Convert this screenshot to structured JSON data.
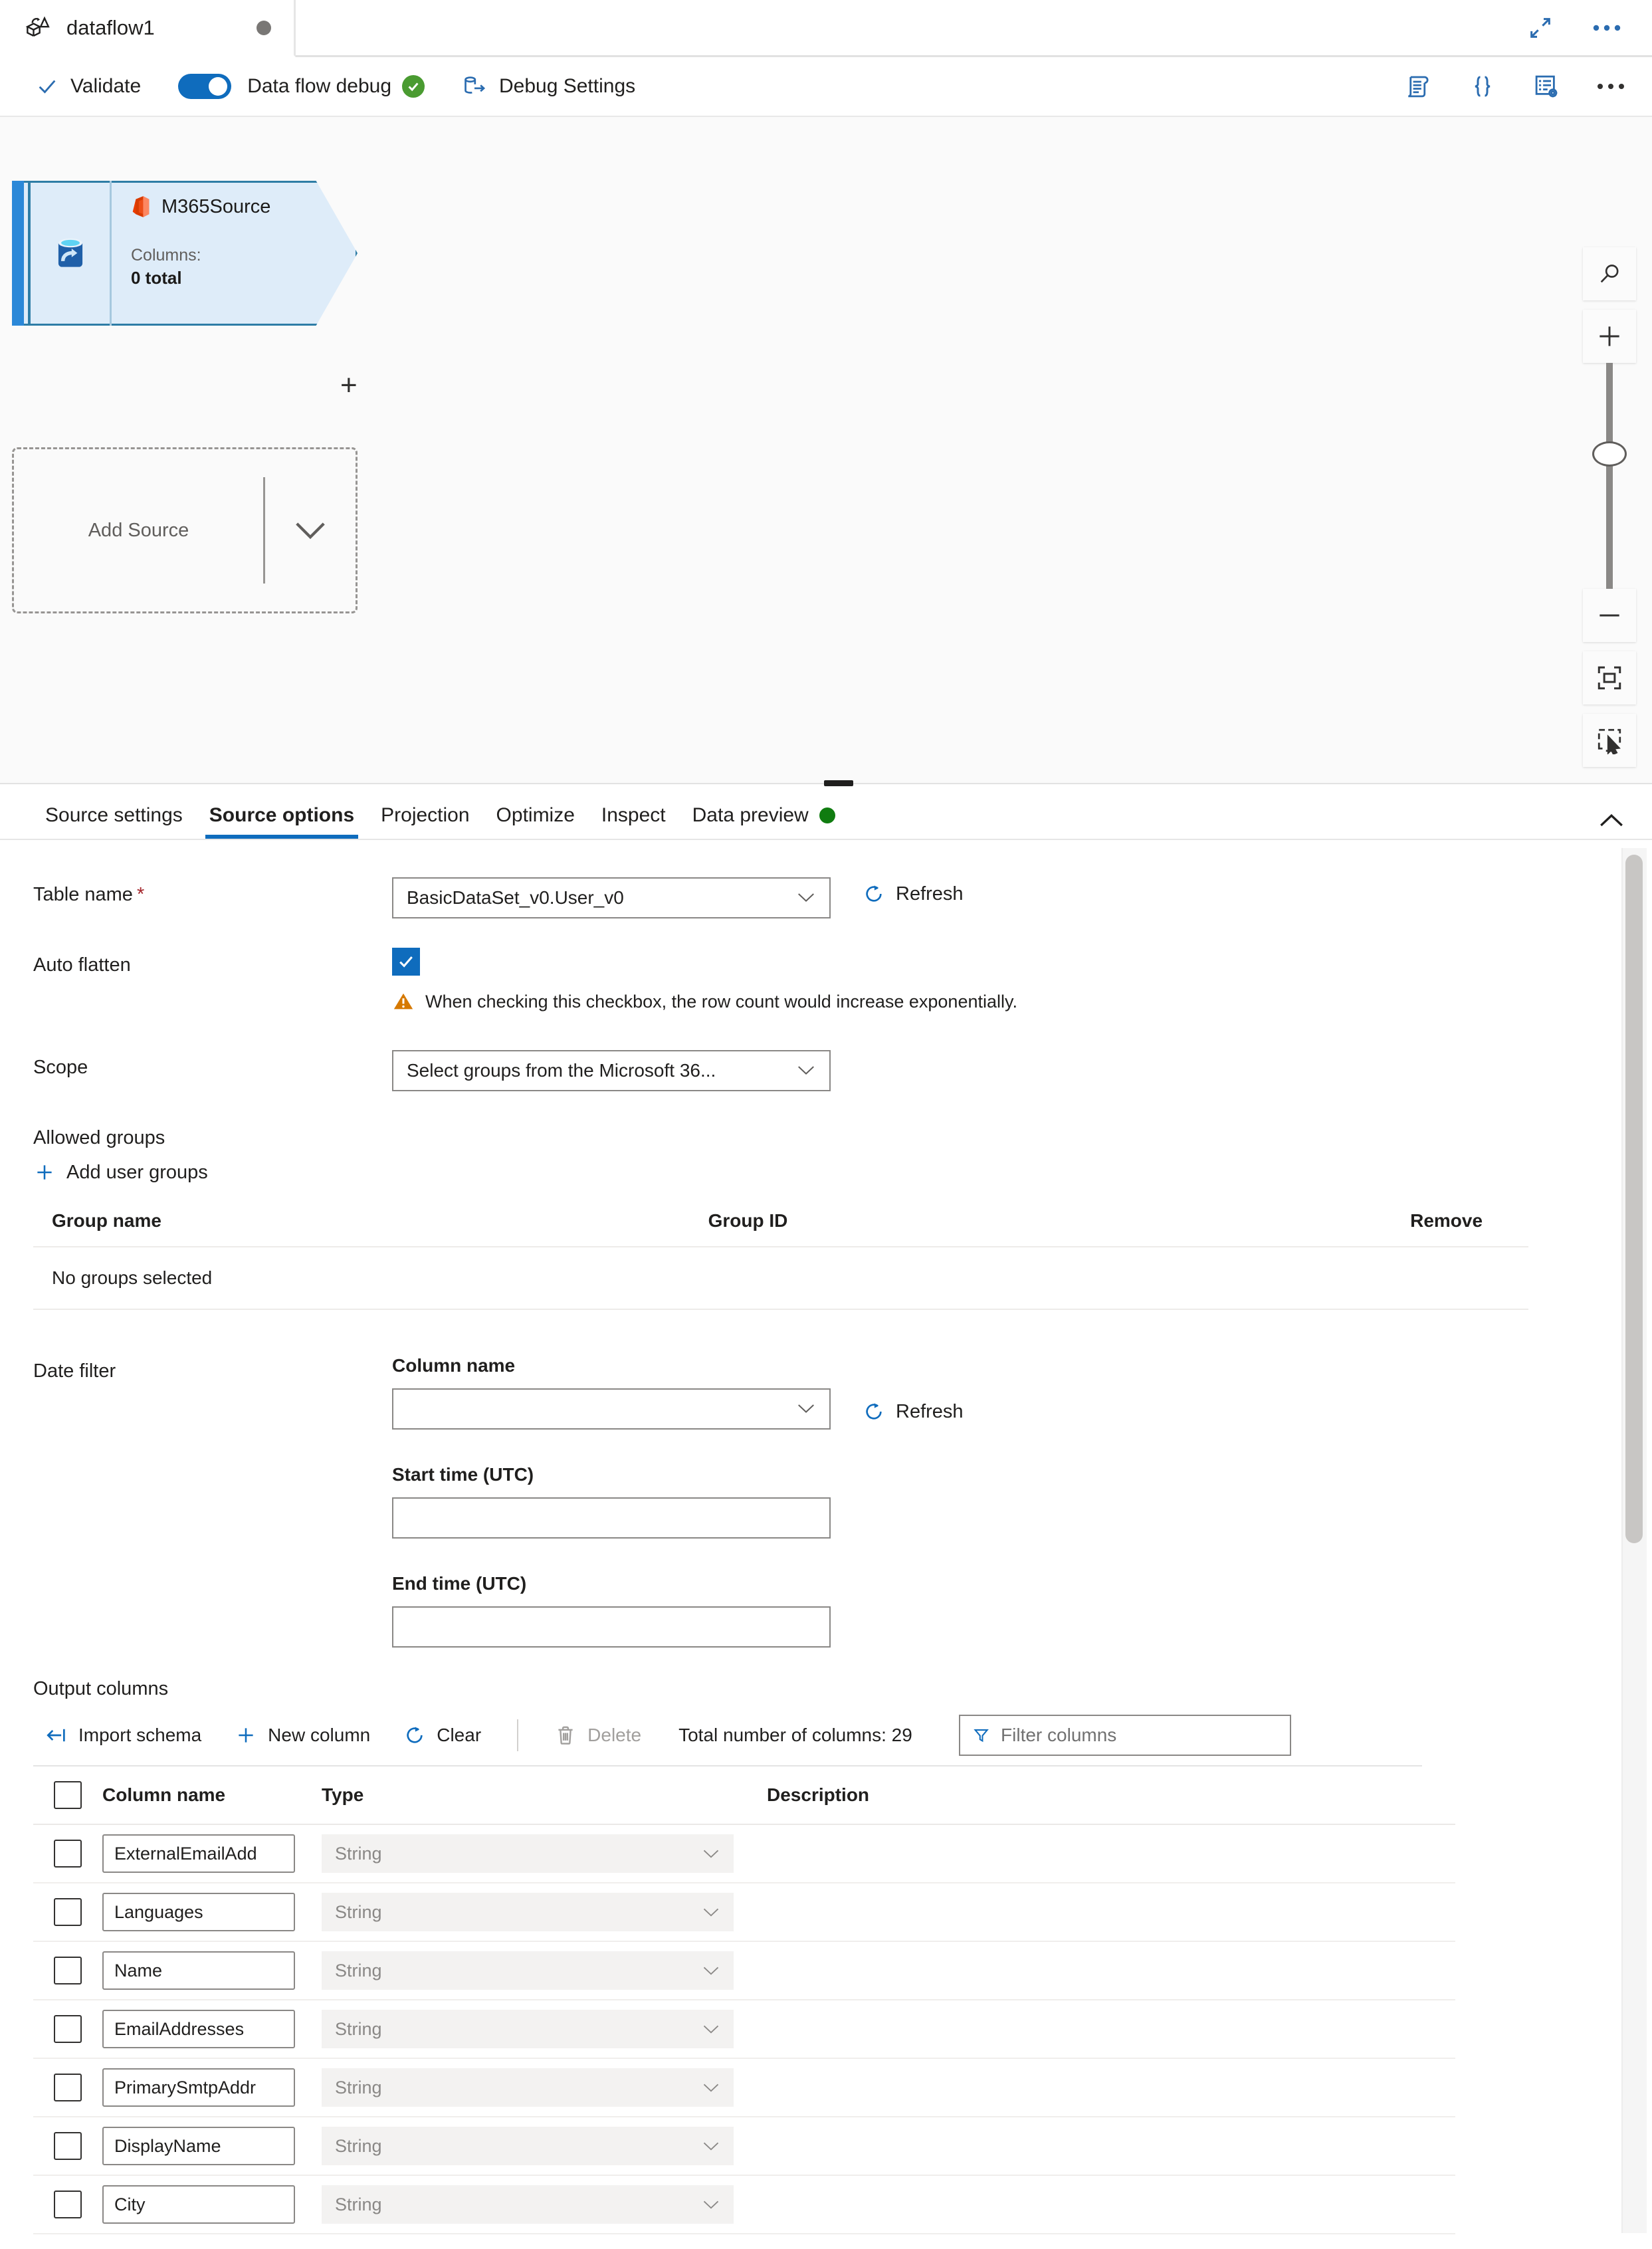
{
  "titlebar": {
    "tab_label": "dataflow1",
    "dirty_indicator": "unsaved-dot",
    "expand_icon": "expand-diagonal-icon",
    "more_icon": "ellipsis-icon"
  },
  "commandbar": {
    "validate_label": "Validate",
    "validate_icon": "checkmark-icon",
    "debug_toggle_label": "Data flow debug",
    "debug_toggle_on": true,
    "debug_status_icon": "success-check-icon",
    "debug_settings_label": "Debug Settings",
    "debug_settings_icon": "database-export-icon",
    "right_icons": [
      {
        "name": "script-icon"
      },
      {
        "name": "code-braces-icon"
      },
      {
        "name": "properties-settings-icon"
      },
      {
        "name": "ellipsis-icon"
      }
    ]
  },
  "canvas": {
    "source_node": {
      "title": "M365Source",
      "app_icon": "office365-icon",
      "stream_icon": "source-database-icon",
      "columns_label": "Columns:",
      "columns_value": "0 total",
      "add_output_icon": "plus-icon"
    },
    "add_source": {
      "label": "Add Source",
      "caret_icon": "chevron-down-icon"
    },
    "controls": [
      {
        "name": "search-canvas-icon"
      },
      {
        "name": "zoom-in-icon"
      },
      {
        "name": "zoom-slider"
      },
      {
        "name": "zoom-out-icon"
      },
      {
        "name": "fit-to-screen-icon"
      },
      {
        "name": "selection-mode-icon"
      }
    ]
  },
  "panel": {
    "tabs": [
      {
        "label": "Source settings",
        "active": false
      },
      {
        "label": "Source options",
        "active": true
      },
      {
        "label": "Projection",
        "active": false
      },
      {
        "label": "Optimize",
        "active": false
      },
      {
        "label": "Inspect",
        "active": false
      },
      {
        "label": "Data preview",
        "active": false,
        "dot": true
      }
    ],
    "collapse_icon": "chevron-up-icon"
  },
  "source_options": {
    "table_name": {
      "label": "Table name",
      "required_marker": "*",
      "value": "BasicDataSet_v0.User_v0",
      "refresh_label": "Refresh",
      "refresh_icon": "refresh-icon"
    },
    "auto_flatten": {
      "label": "Auto flatten",
      "checked": true,
      "warning_icon": "warning-triangle-icon",
      "warning_text": "When checking this checkbox, the row count would increase exponentially."
    },
    "scope": {
      "label": "Scope",
      "value": "Select groups from the Microsoft 36..."
    },
    "allowed_groups": {
      "title": "Allowed groups",
      "add_label": "Add user groups",
      "add_icon": "plus-icon",
      "columns": [
        "Group name",
        "Group ID",
        "Remove"
      ],
      "empty_text": "No groups selected"
    },
    "date_filter": {
      "label": "Date filter",
      "column_name_label": "Column name",
      "column_name_value": "",
      "refresh_label": "Refresh",
      "refresh_icon": "refresh-icon",
      "start_time_label": "Start time (UTC)",
      "start_time_value": "",
      "end_time_label": "End time (UTC)",
      "end_time_value": ""
    }
  },
  "output_columns": {
    "title": "Output columns",
    "toolbar": {
      "import_schema_label": "Import schema",
      "import_schema_icon": "import-arrow-icon",
      "new_column_label": "New column",
      "new_column_icon": "plus-icon",
      "clear_label": "Clear",
      "clear_icon": "refresh-icon",
      "delete_label": "Delete",
      "delete_icon": "trash-icon",
      "delete_disabled": true,
      "total_label": "Total number of columns: 29",
      "filter_placeholder": "Filter columns",
      "filter_value": "",
      "filter_icon": "funnel-icon"
    },
    "headers": [
      "Column name",
      "Type",
      "Description"
    ],
    "rows": [
      {
        "name": "ExternalEmailAdd",
        "type": "String",
        "description": "",
        "selected": false
      },
      {
        "name": "Languages",
        "type": "String",
        "description": "",
        "selected": false
      },
      {
        "name": "Name",
        "type": "String",
        "description": "",
        "selected": false
      },
      {
        "name": "EmailAddresses",
        "type": "String",
        "description": "",
        "selected": false
      },
      {
        "name": "PrimarySmtpAddr",
        "type": "String",
        "description": "",
        "selected": false
      },
      {
        "name": "DisplayName",
        "type": "String",
        "description": "",
        "selected": false
      },
      {
        "name": "City",
        "type": "String",
        "description": "",
        "selected": false
      }
    ]
  },
  "colors": {
    "accent": "#0f6cbd",
    "node_fill": "#deecf9",
    "node_border": "#2e7da6",
    "success": "#107c10",
    "warning": "#d67900",
    "required": "#a4262c"
  }
}
